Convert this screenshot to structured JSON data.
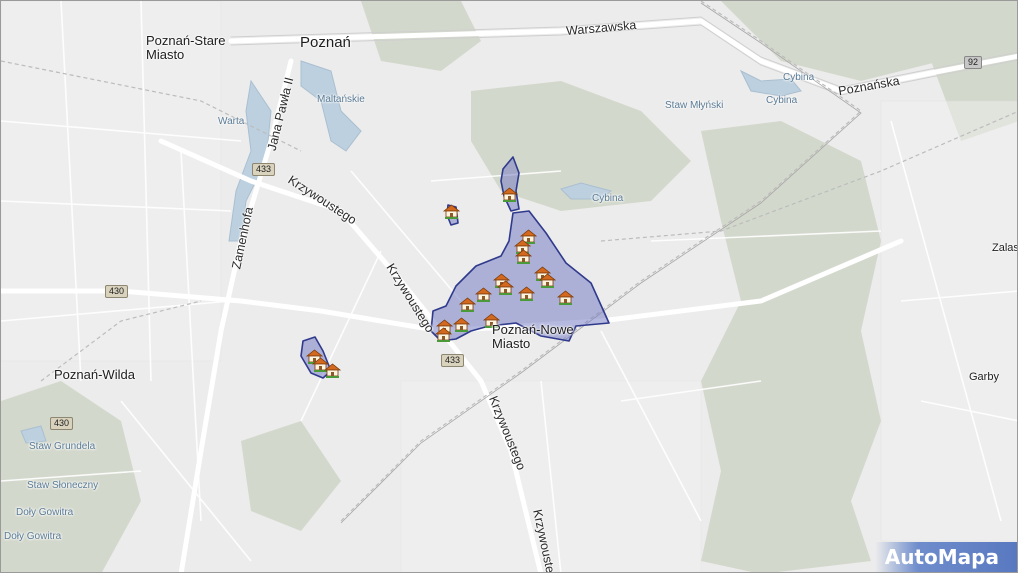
{
  "map": {
    "places": [
      {
        "id": "poznan-stare-miasto",
        "text": "Poznań-Stare\nMiasto"
      },
      {
        "id": "poznan",
        "text": "Poznań"
      },
      {
        "id": "poznan-nowe-miasto",
        "text": "Poznań-Nowe\nMiasto"
      },
      {
        "id": "poznan-wilda",
        "text": "Poznań-Wilda"
      },
      {
        "id": "garby",
        "text": "Garby"
      },
      {
        "id": "zalasewo",
        "text": "Zalas"
      }
    ],
    "roads": [
      {
        "id": "warszawska",
        "text": "Warszawska"
      },
      {
        "id": "poznanska",
        "text": "Poznańska"
      },
      {
        "id": "jana-pawla-ii",
        "text": "Jana Pawła II"
      },
      {
        "id": "krzywoustego-1",
        "text": "Krzywoustego"
      },
      {
        "id": "krzywoustego-2",
        "text": "Krzywoustego"
      },
      {
        "id": "krzywoustego-3",
        "text": "Krzywoustego"
      },
      {
        "id": "krzywoustego-4",
        "text": "Krzywoustego"
      },
      {
        "id": "zamenhofa",
        "text": "Zamenhofa"
      }
    ],
    "water": [
      {
        "id": "maltanskie",
        "text": "Maltańskie"
      },
      {
        "id": "warta",
        "text": "Warta"
      },
      {
        "id": "cybina-1",
        "text": "Cybina"
      },
      {
        "id": "cybina-2",
        "text": "Cybina"
      },
      {
        "id": "cybina-3",
        "text": "Cybina"
      },
      {
        "id": "staw-mlynski",
        "text": "Staw Młyński"
      },
      {
        "id": "staw-grundela",
        "text": "Staw Grundela"
      },
      {
        "id": "staw-sloneczny",
        "text": "Staw Słoneczny"
      },
      {
        "id": "doly-gowitra",
        "text": "Doły Gowitra"
      },
      {
        "id": "doly-gowitra-2",
        "text": "Doły Gowitra"
      }
    ],
    "shields": [
      {
        "id": "s433a",
        "text": "433"
      },
      {
        "id": "s433b",
        "text": "433"
      },
      {
        "id": "s430a",
        "text": "430"
      },
      {
        "id": "s430b",
        "text": "430"
      },
      {
        "id": "s92",
        "text": "92"
      }
    ],
    "highlight_color": "#7a7fc4",
    "highlight_border": "#2f3a8c",
    "marker_icon": "house-marker-icon",
    "marker_count": 20
  },
  "brand": {
    "text": "AutoMapa"
  }
}
